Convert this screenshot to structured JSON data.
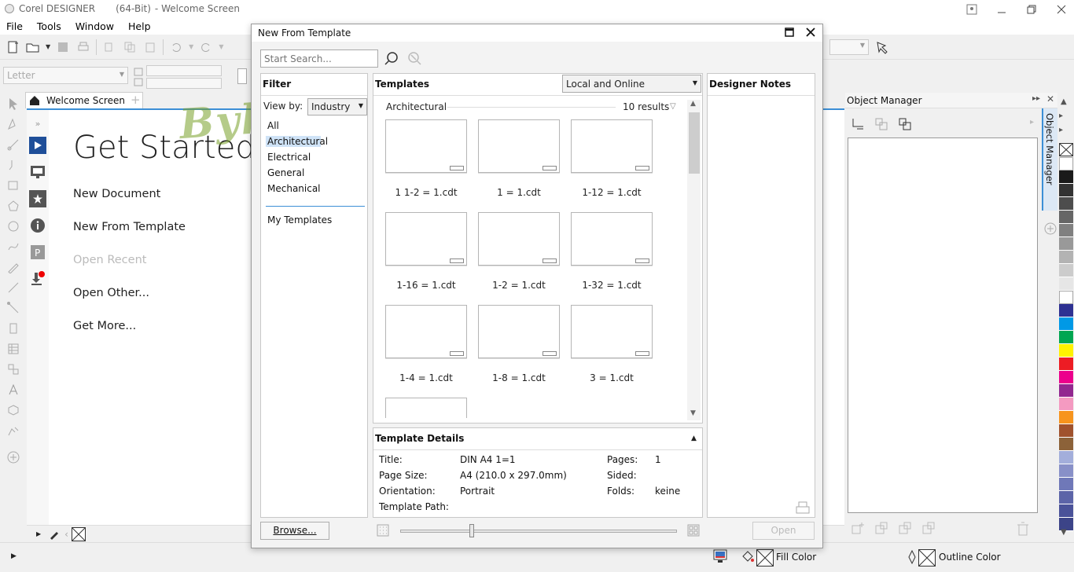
{
  "app": {
    "title": "Corel DESIGNER",
    "bitness": "(64-Bit)",
    "document": "- Welcome Screen"
  },
  "menu": [
    "File",
    "Tools",
    "Window",
    "Help"
  ],
  "toolbar2": {
    "paper_size": "Letter"
  },
  "tab": {
    "label": "Welcome Screen"
  },
  "welcome": {
    "title": "Get Started",
    "links": [
      "New Document",
      "New From Template",
      "Open Recent",
      "Open Other...",
      "Get More..."
    ]
  },
  "dialog": {
    "title": "New From Template",
    "search_placeholder": "Start Search...",
    "filter": {
      "header": "Filter",
      "view_by_label": "View by:",
      "view_by_value": "Industry",
      "items": [
        "All",
        "Architectural",
        "Electrical",
        "General",
        "Mechanical"
      ],
      "my_templates": "My Templates"
    },
    "templates": {
      "header": "Templates",
      "source": "Local and Online",
      "category": "Architectural",
      "results": "10 results",
      "items": [
        "1 1-2 = 1.cdt",
        "1 = 1.cdt",
        "1-12 = 1.cdt",
        "1-16 = 1.cdt",
        "1-2 = 1.cdt",
        "1-32 = 1.cdt",
        "1-4 = 1.cdt",
        "1-8 = 1.cdt",
        "3 = 1.cdt"
      ]
    },
    "notes": {
      "header": "Designer Notes"
    },
    "details": {
      "header": "Template Details",
      "title_label": "Title:",
      "title_value": "DIN A4 1=1",
      "pagesize_label": "Page Size:",
      "pagesize_value": "A4 (210.0 x 297.0mm)",
      "orientation_label": "Orientation:",
      "orientation_value": "Portrait",
      "path_label": "Template Path:",
      "pages_label": "Pages:",
      "pages_value": "1",
      "sided_label": "Sided:",
      "folds_label": "Folds:",
      "folds_value": "keine"
    },
    "browse_button": "Browse...",
    "open_button": "Open"
  },
  "object_manager": {
    "title": "Object Manager",
    "tab_label": "Object Manager"
  },
  "status": {
    "fill": "Fill Color",
    "outline": "Outline Color"
  },
  "watermark": "ByhAaMe",
  "palette": [
    "#ffffff",
    "#1a1a1a",
    "#333333",
    "#4d4d4d",
    "#666666",
    "#808080",
    "#999999",
    "#b3b3b3",
    "#cccccc",
    "#e6e6e6",
    "#ffffff",
    "#2e3192",
    "#0099e6",
    "#00a651",
    "#fff200",
    "#ed1c24",
    "#ec008c",
    "#92278f",
    "#f49ac1",
    "#f7941d",
    "#a0522d",
    "#8c6239",
    "#a3aedb",
    "#8890c8",
    "#6f78b8",
    "#5c64a8",
    "#4a5299",
    "#3c4488"
  ]
}
